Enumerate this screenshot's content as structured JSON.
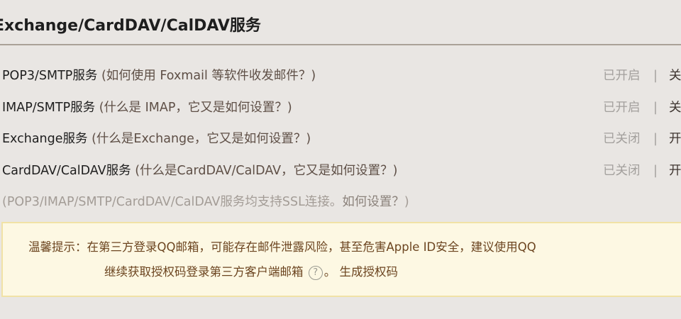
{
  "section_title": "Exchange/CardDAV/CalDAV服务",
  "services": [
    {
      "name": "POP3/SMTP服务",
      "help": "(如何使用 Foxmail 等软件收发邮件？)",
      "status": "已开启",
      "separator": "|",
      "action": "关"
    },
    {
      "name": "IMAP/SMTP服务",
      "help": "(什么是 IMAP，它又是如何设置？)",
      "status": "已开启",
      "separator": "|",
      "action": "关"
    },
    {
      "name": "Exchange服务",
      "help": "(什么是Exchange，它又是如何设置？)",
      "status": "已关闭",
      "separator": "|",
      "action": "开"
    },
    {
      "name": "CardDAV/CalDAV服务",
      "help": "(什么是CardDAV/CalDAV，它又是如何设置？)",
      "status": "已关闭",
      "separator": "|",
      "action": "开"
    }
  ],
  "ssl_note": {
    "text": "(POP3/IMAP/SMTP/CardDAV/CalDAV服务均支持SSL连接。",
    "link": "如何设置？",
    "close": ")"
  },
  "notice": {
    "label": "温馨提示：",
    "line1": "在第三方登录QQ邮箱，可能存在邮件泄露风险，甚至危害Apple ID安全，建议使用QQ",
    "line2": "继续获取授权码登录第三方客户端邮箱",
    "help_icon": "question-circle-icon",
    "period": "。",
    "generate_link": "生成授权码"
  },
  "colors": {
    "background": "#e9e6e3",
    "notice_bg": "#fdf8e3",
    "notice_border": "#f1e2a6",
    "notice_text": "#6c4520"
  }
}
